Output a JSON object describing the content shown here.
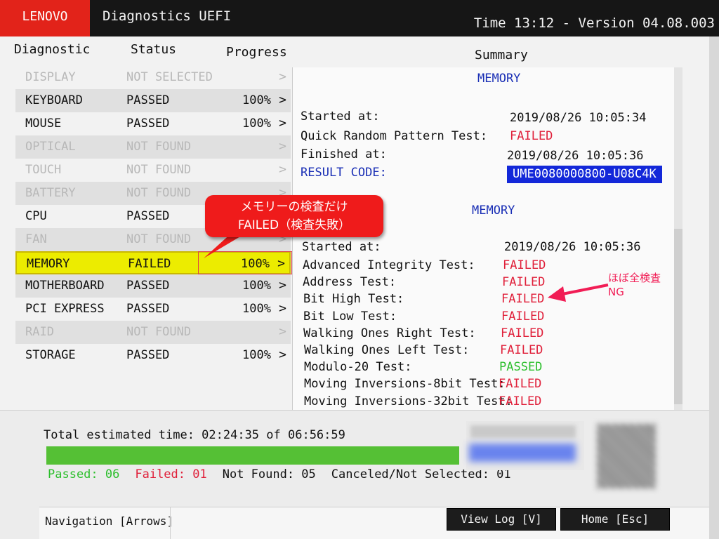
{
  "header": {
    "brand": "LENOVO",
    "title": "Diagnostics UEFI",
    "time_version": "Time 13:12 - Version 04.08.003"
  },
  "columns": {
    "diagnostic": "Diagnostic",
    "status": "Status",
    "progress": "Progress",
    "summary": "Summary"
  },
  "diagnostics": [
    {
      "name": "DISPLAY",
      "status": "NOT SELECTED",
      "progress": ""
    },
    {
      "name": "KEYBOARD",
      "status": "PASSED",
      "progress": "100%"
    },
    {
      "name": "MOUSE",
      "status": "PASSED",
      "progress": "100%"
    },
    {
      "name": "OPTICAL",
      "status": "NOT FOUND",
      "progress": ""
    },
    {
      "name": "TOUCH",
      "status": "NOT FOUND",
      "progress": ""
    },
    {
      "name": "BATTERY",
      "status": "NOT FOUND",
      "progress": ""
    },
    {
      "name": "CPU",
      "status": "PASSED",
      "progress": ""
    },
    {
      "name": "FAN",
      "status": "NOT FOUND",
      "progress": ""
    },
    {
      "name": "MEMORY",
      "status": "FAILED",
      "progress": "100%"
    },
    {
      "name": "MOTHERBOARD",
      "status": "PASSED",
      "progress": "100%"
    },
    {
      "name": "PCI EXPRESS",
      "status": "PASSED",
      "progress": "100%"
    },
    {
      "name": "RAID",
      "status": "NOT FOUND",
      "progress": ""
    },
    {
      "name": "STORAGE",
      "status": "PASSED",
      "progress": "100%"
    }
  ],
  "chevron": ">",
  "summary": {
    "section1": {
      "title": "MEMORY",
      "started_label": "Started at:",
      "started_value": "2019/08/26 10:05:34",
      "quick_label": "Quick Random Pattern Test:",
      "quick_value": "FAILED",
      "finished_label": "Finished at:",
      "finished_value": "2019/08/26 10:05:36",
      "result_label": "RESULT CODE:",
      "result_value": "UME0080000800-U08C4K"
    },
    "section2": {
      "title": "MEMORY",
      "started_label": "Started at:",
      "started_value": "2019/08/26 10:05:36",
      "tests": [
        {
          "label": "Advanced Integrity Test:",
          "value": "FAILED"
        },
        {
          "label": "Address Test:",
          "value": "FAILED"
        },
        {
          "label": "Bit High Test:",
          "value": "FAILED"
        },
        {
          "label": "Bit Low Test:",
          "value": "FAILED"
        },
        {
          "label": "Walking Ones Right Test:",
          "value": "FAILED"
        },
        {
          "label": "Walking Ones Left Test:",
          "value": "FAILED"
        },
        {
          "label": "Modulo-20 Test:",
          "value": "PASSED"
        },
        {
          "label": "Moving Inversions-8bit Test:",
          "value": "FAILED"
        },
        {
          "label": "Moving Inversions-32bit Test:",
          "value": "FAILED"
        }
      ]
    }
  },
  "annotations": {
    "callout_line1": "メモリーの検査だけ",
    "callout_line2": "FAILED（検査失敗）",
    "ng_line1": "ほぼ全検査",
    "ng_line2": "NG"
  },
  "bottom": {
    "total_time": "Total estimated time: 02:24:35 of 06:56:59",
    "progress_fraction": 1.0,
    "passed": "Passed: 06",
    "failed": "Failed: 01",
    "not_found": "Not Found: 05",
    "canceled": "Canceled/Not Selected: 01"
  },
  "nav": {
    "label": "Navigation [Arrows]",
    "view_log": "View Log [V]",
    "home": "Home [Esc]"
  },
  "colors": {
    "brand_red": "#e2231a",
    "fail_red": "#e0203a",
    "pass_green": "#2dbf2d",
    "title_blue": "#1a2fb5",
    "highlight_yellow": "#ecec00"
  }
}
